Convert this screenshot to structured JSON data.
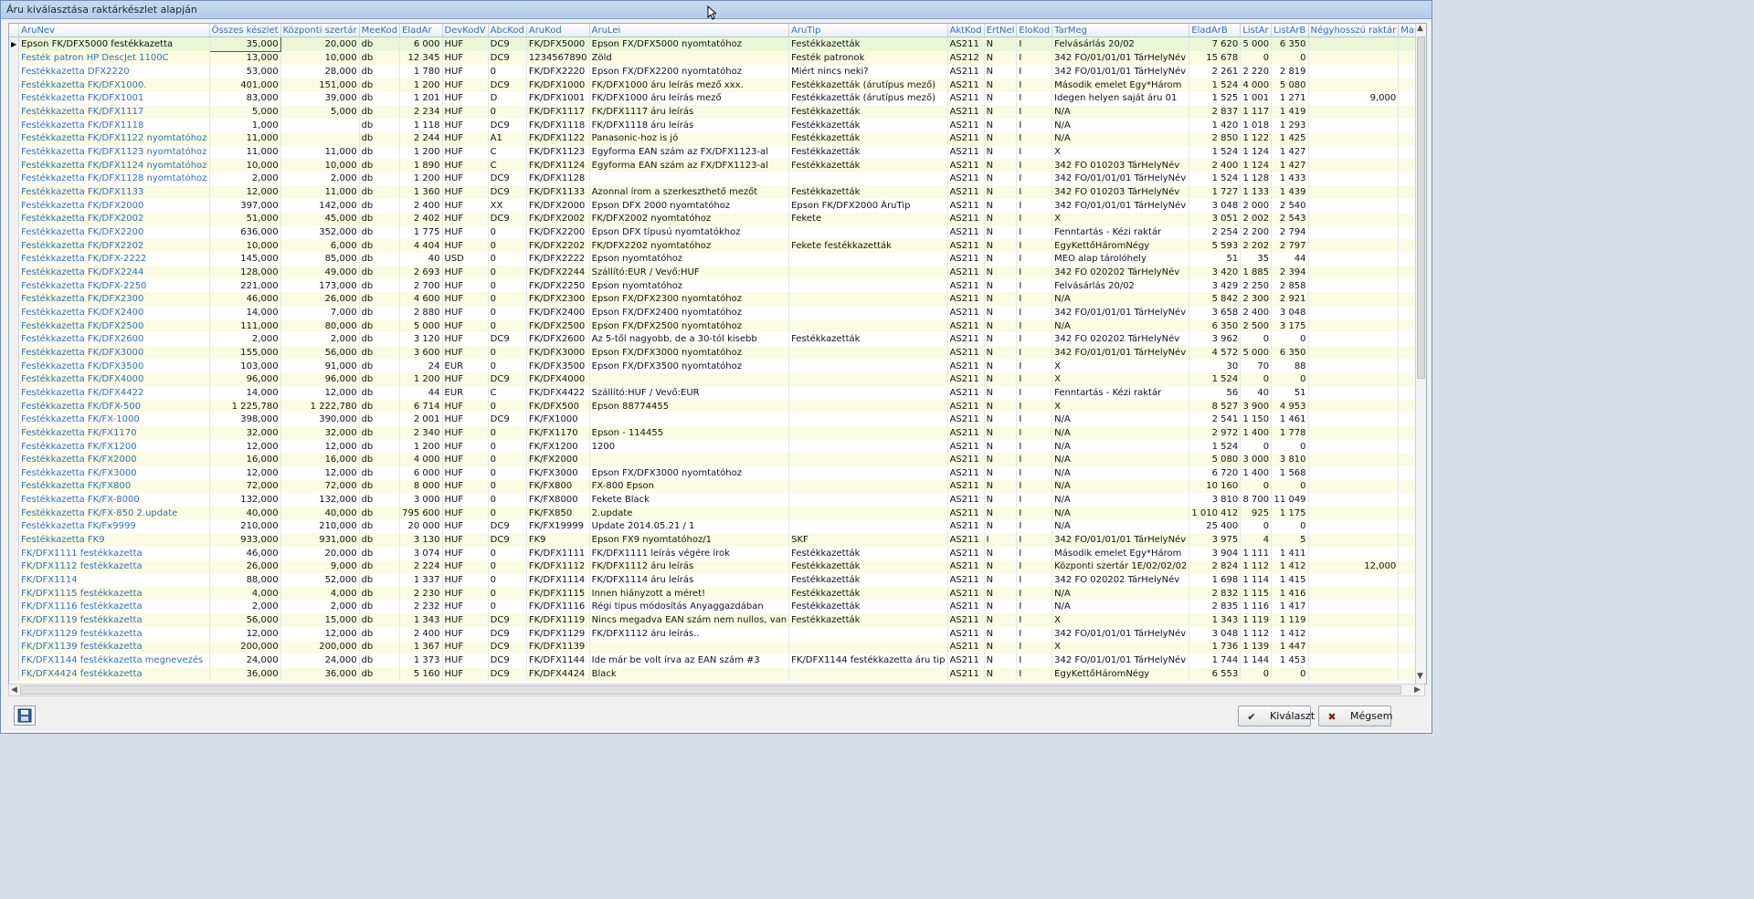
{
  "window": {
    "title": "Áru kiválasztása raktárkészlet alapján"
  },
  "grid": {
    "columns": [
      "AruNev",
      "Összes készlet",
      "Központi szertár",
      "MeeKod",
      "EladAr",
      "DevKodV",
      "AbcKod",
      "AruKod",
      "AruLei",
      "AruTip",
      "AktKod",
      "ErtNel",
      "EloKod",
      "TarMeg",
      "EladArB",
      "ListAr",
      "ListArB",
      "Négyhosszú raktár",
      "Mark"
    ],
    "rows": [
      [
        "Epson FK/DFX5000 festékkazetta",
        "35,000",
        "20,000",
        "db",
        "6 000",
        "HUF",
        "DC9",
        "FK/DFX5000",
        "Epson FX/DFX5000 nyomtatóhoz",
        "Festékkazetták",
        "AS211",
        "N",
        "I",
        "Felvásárlás 20/02",
        "7 620",
        "5 000",
        "6 350",
        "",
        ""
      ],
      [
        "Festék patron HP DescJet 1100C",
        "13,000",
        "10,000",
        "db",
        "12 345",
        "HUF",
        "DC9",
        "1234567890",
        "Zöld",
        "Festék patronok",
        "AS212",
        "N",
        "I",
        "342 FO/01/01/01 TárHelyNév",
        "15 678",
        "0",
        "0",
        "",
        ""
      ],
      [
        "Festékkazetta DFX2220",
        "53,000",
        "28,000",
        "db",
        "1 780",
        "HUF",
        "0",
        "FK/DFX2220",
        "Epson FX/DFX2200 nyomtatóhoz",
        "Miért nincs neki?",
        "AS211",
        "N",
        "I",
        "342 FO/01/01/01 TárHelyNév",
        "2 261",
        "2 220",
        "2 819",
        "",
        ""
      ],
      [
        "Festékkazetta FK/DFX1000.",
        "401,000",
        "151,000",
        "db",
        "1 200",
        "HUF",
        "DC9",
        "FK/DFX1000",
        "FK/DFX1000 áru leírás mező xxx.",
        "Festékkazetták (árutípus mező)",
        "AS211",
        "N",
        "I",
        "Második emelet Egy*Három",
        "1 524",
        "4 000",
        "5 080",
        "",
        ""
      ],
      [
        "Festékkazetta FK/DFX1001",
        "83,000",
        "39,000",
        "db",
        "1 201",
        "HUF",
        "D",
        "FK/DFX1001",
        "FK/DFX1000 áru leírás mező",
        "Festékkazetták (árutípus mező)",
        "AS211",
        "N",
        "I",
        "Idegen helyen saját áru 01",
        "1 525",
        "1 001",
        "1 271",
        "9,000",
        ""
      ],
      [
        "Festékkazetta FK/DFX1117",
        "5,000",
        "5,000",
        "db",
        "2 234",
        "HUF",
        "0",
        "FK/DFX1117",
        "FK/DFX1117 áru leírás",
        "Festékkazetták",
        "AS211",
        "N",
        "I",
        "N/A",
        "2 837",
        "1 117",
        "1 419",
        "",
        ""
      ],
      [
        "Festékkazetta FK/DFX1118",
        "1,000",
        "",
        "db",
        "1 118",
        "HUF",
        "DC9",
        "FK/DFX1118",
        "FK/DFX1118 áru leírás",
        "Festékkazetták",
        "AS211",
        "N",
        "I",
        "N/A",
        "1 420",
        "1 018",
        "1 293",
        "",
        ""
      ],
      [
        "Festékkazetta FK/DFX1122 nyomtatóhoz",
        "11,000",
        "",
        "db",
        "2 244",
        "HUF",
        "A1",
        "FK/DFX1122",
        "Panasonic-hoz is jó",
        "Festékkazetták",
        "AS211",
        "N",
        "I",
        "N/A",
        "2 850",
        "1 122",
        "1 425",
        "",
        ""
      ],
      [
        "Festékkazetta FK/DFX1123 nyomtatóhoz",
        "11,000",
        "11,000",
        "db",
        "1 200",
        "HUF",
        "C",
        "FK/DFX1123",
        "Egyforma EAN szám az FX/DFX1123-al",
        "Festékkazetták",
        "AS211",
        "N",
        "I",
        "X",
        "1 524",
        "1 124",
        "1 427",
        "",
        ""
      ],
      [
        "Festékkazetta FK/DFX1124 nyomtatóhoz",
        "10,000",
        "10,000",
        "db",
        "1 890",
        "HUF",
        "C",
        "FK/DFX1124",
        "Egyforma EAN szám az FX/DFX1123-al",
        "Festékkazetták",
        "AS211",
        "N",
        "I",
        "342 FO 010203  TárHelyNév",
        "2 400",
        "1 124",
        "1 427",
        "",
        ""
      ],
      [
        "Festékkazetta FK/DFX1128 nyomtatóhoz",
        "2,000",
        "2,000",
        "db",
        "1 200",
        "HUF",
        "DC9",
        "FK/DFX1128",
        "",
        "",
        "AS211",
        "N",
        "I",
        "342 FO/01/01/01 TárHelyNév",
        "1 524",
        "1 128",
        "1 433",
        "",
        ""
      ],
      [
        "Festékkazetta FK/DFX1133",
        "12,000",
        "11,000",
        "db",
        "1 360",
        "HUF",
        "DC9",
        "FK/DFX1133",
        "Azonnal írom a szerkeszthető mezőt",
        "Festékkazetták",
        "AS211",
        "N",
        "I",
        "342 FO 010203  TárHelyNév",
        "1 727",
        "1 133",
        "1 439",
        "",
        ""
      ],
      [
        "Festékkazetta FK/DFX2000",
        "397,000",
        "142,000",
        "db",
        "2 400",
        "HUF",
        "XX",
        "FK/DFX2000",
        "Epson DFX 2000 nyomtatóhoz",
        "Epson FK/DFX2000 ÁruTip",
        "AS211",
        "N",
        "I",
        "342 FO/01/01/01 TárHelyNév",
        "3 048",
        "2 000",
        "2 540",
        "",
        ""
      ],
      [
        "Festékkazetta FK/DFX2002",
        "51,000",
        "45,000",
        "db",
        "2 402",
        "HUF",
        "DC9",
        "FK/DFX2002",
        "FK/DFX2002 nyomtatóhoz",
        "Fekete",
        "AS211",
        "N",
        "I",
        "X",
        "3 051",
        "2 002",
        "2 543",
        "",
        ""
      ],
      [
        "Festékkazetta FK/DFX2200",
        "636,000",
        "352,000",
        "db",
        "1 775",
        "HUF",
        "0",
        "FK/DFX2200",
        "Epson DFX típusú nyomtatókhoz",
        "",
        "AS211",
        "N",
        "I",
        "Fenntartás - Kézi raktár",
        "2 254",
        "2 200",
        "2 794",
        "",
        ""
      ],
      [
        "Festékkazetta FK/DFX2202",
        "10,000",
        "6,000",
        "db",
        "4 404",
        "HUF",
        "0",
        "FK/DFX2202",
        "FK/DFX2202 nyomtatóhoz",
        "Fekete festékkazetták",
        "AS211",
        "N",
        "I",
        "EgyKettőHáromNégy",
        "5 593",
        "2 202",
        "2 797",
        "",
        ""
      ],
      [
        "Festékkazetta FK/DFX-2222",
        "145,000",
        "85,000",
        "db",
        "40",
        "USD",
        "0",
        "FK/DFX2222",
        "Epson nyomtatóhoz",
        "",
        "AS211",
        "N",
        "I",
        "MEO alap tárolóhely",
        "51",
        "35",
        "44",
        "",
        ""
      ],
      [
        "Festékkazetta FK/DFX2244",
        "128,000",
        "49,000",
        "db",
        "2 693",
        "HUF",
        "0",
        "FK/DFX2244",
        "Szállító:EUR / Vevő:HUF",
        "",
        "AS211",
        "N",
        "I",
        "342 FO 020202  TárHelyNév",
        "3 420",
        "1 885",
        "2 394",
        "",
        ""
      ],
      [
        "Festékkazetta FK/DFX-2250",
        "221,000",
        "173,000",
        "db",
        "2 700",
        "HUF",
        "0",
        "FK/DFX2250",
        "Epson nyomtatóhoz",
        "",
        "AS211",
        "N",
        "I",
        "Felvásárlás 20/02",
        "3 429",
        "2 250",
        "2 858",
        "",
        ""
      ],
      [
        "Festékkazetta FK/DFX2300",
        "46,000",
        "26,000",
        "db",
        "4 600",
        "HUF",
        "0",
        "FK/DFX2300",
        "Epson FX/DFX2300 nyomtatóhoz",
        "",
        "AS211",
        "N",
        "I",
        "N/A",
        "5 842",
        "2 300",
        "2 921",
        "",
        ""
      ],
      [
        "Festékkazetta FK/DFX2400",
        "14,000",
        "7,000",
        "db",
        "2 880",
        "HUF",
        "0",
        "FK/DFX2400",
        "Epson FX/DFX2400 nyomtatóhoz",
        "",
        "AS211",
        "N",
        "I",
        "342 FO/01/01/01 TárHelyNév",
        "3 658",
        "2 400",
        "3 048",
        "",
        ""
      ],
      [
        "Festékkazetta FK/DFX2500",
        "111,000",
        "80,000",
        "db",
        "5 000",
        "HUF",
        "0",
        "FK/DFX2500",
        "Epson FX/DFX2500 nyomtatóhoz",
        "",
        "AS211",
        "N",
        "I",
        "N/A",
        "6 350",
        "2 500",
        "3 175",
        "",
        ""
      ],
      [
        "Festékkazetta FK/DFX2600",
        "2,000",
        "2,000",
        "db",
        "3 120",
        "HUF",
        "DC9",
        "FK/DFX2600",
        "Az 5-től nagyobb, de a 30-tól kisebb",
        "Festékkazetták",
        "AS211",
        "N",
        "I",
        "342 FO 020202  TárHelyNév",
        "3 962",
        "0",
        "0",
        "",
        ""
      ],
      [
        "Festékkazetta FK/DFX3000",
        "155,000",
        "56,000",
        "db",
        "3 600",
        "HUF",
        "0",
        "FK/DFX3000",
        "Epson FX/DFX3000 nyomtatóhoz",
        "",
        "AS211",
        "N",
        "I",
        "342 FO/01/01/01 TárHelyNév",
        "4 572",
        "5 000",
        "6 350",
        "",
        ""
      ],
      [
        "Festékkazetta FK/DFX3500",
        "103,000",
        "91,000",
        "db",
        "24",
        "EUR",
        "0",
        "FK/DFX3500",
        "Epson FX/DFX3500 nyomtatóhoz",
        "",
        "AS211",
        "N",
        "I",
        "X",
        "30",
        "70",
        "88",
        "",
        ""
      ],
      [
        "Festékkazetta FK/DFX4000",
        "96,000",
        "96,000",
        "db",
        "1 200",
        "HUF",
        "DC9",
        "FK/DFX4000",
        "",
        "",
        "AS211",
        "N",
        "I",
        "X",
        "1 524",
        "0",
        "0",
        "",
        ""
      ],
      [
        "Festékkazetta FK/DFX4422",
        "14,000",
        "12,000",
        "db",
        "44",
        "EUR",
        "C",
        "FK/DFX4422",
        "Szállító:HUF / Vevő:EUR",
        "",
        "AS211",
        "N",
        "I",
        "Fenntartás - Kézi raktár",
        "56",
        "40",
        "51",
        "",
        ""
      ],
      [
        "Festékkazetta FK/DFX-500",
        "1 225,780",
        "1 222,780",
        "db",
        "6 714",
        "HUF",
        "0",
        "FK/DFX500",
        "Epson 88774455",
        "",
        "AS211",
        "N",
        "I",
        "X",
        "8 527",
        "3 900",
        "4 953",
        "",
        ""
      ],
      [
        "Festékkazetta FK/FX-1000",
        "398,000",
        "390,000",
        "db",
        "2 001",
        "HUF",
        "DC9",
        "FK/FX1000",
        "",
        "",
        "AS211",
        "N",
        "I",
        "N/A",
        "2 541",
        "1 150",
        "1 461",
        "",
        ""
      ],
      [
        "Festékkazetta FK/FX1170",
        "32,000",
        "32,000",
        "db",
        "2 340",
        "HUF",
        "0",
        "FK/FX1170",
        "Epson - 114455",
        "",
        "AS211",
        "N",
        "I",
        "N/A",
        "2 972",
        "1 400",
        "1 778",
        "",
        ""
      ],
      [
        "Festékkazetta FK/FX1200",
        "12,000",
        "12,000",
        "db",
        "1 200",
        "HUF",
        "0",
        "FK/FX1200",
        "1200",
        "",
        "AS211",
        "N",
        "I",
        "N/A",
        "1 524",
        "0",
        "0",
        "",
        ""
      ],
      [
        "Festékkazetta FK/FX2000",
        "16,000",
        "16,000",
        "db",
        "4 000",
        "HUF",
        "0",
        "FK/FX2000",
        "",
        "",
        "AS211",
        "N",
        "I",
        "N/A",
        "5 080",
        "3 000",
        "3 810",
        "",
        ""
      ],
      [
        "Festékkazetta FK/FX3000",
        "12,000",
        "12,000",
        "db",
        "6 000",
        "HUF",
        "0",
        "FK/FX3000",
        "Epson FX/DFX3000 nyomtatóhoz",
        "",
        "AS211",
        "N",
        "I",
        "N/A",
        "6 720",
        "1 400",
        "1 568",
        "",
        ""
      ],
      [
        "Festékkazetta FK/FX800",
        "72,000",
        "72,000",
        "db",
        "8 000",
        "HUF",
        "0",
        "FK/FX800",
        "FX-800 Epson",
        "",
        "AS211",
        "N",
        "I",
        "N/A",
        "10 160",
        "0",
        "0",
        "",
        ""
      ],
      [
        "Festékkazetta FK/FX-8000",
        "132,000",
        "132,000",
        "db",
        "3 000",
        "HUF",
        "0",
        "FK/FX8000",
        "Fekete Black",
        "",
        "AS211",
        "N",
        "I",
        "N/A",
        "3 810",
        "8 700",
        "11 049",
        "",
        ""
      ],
      [
        "Festékkazetta FK/FX-850 2.update",
        "40,000",
        "40,000",
        "db",
        "795 600",
        "HUF",
        "0",
        "FK/FX850",
        "2.update",
        "",
        "AS211",
        "N",
        "I",
        "N/A",
        "1 010 412",
        "925",
        "1 175",
        "",
        ""
      ],
      [
        "Festékkazetta FK/Fx9999",
        "210,000",
        "210,000",
        "db",
        "20 000",
        "HUF",
        "DC9",
        "FK/FX19999",
        "Update 2014.05.21 / 1",
        "",
        "AS211",
        "N",
        "I",
        "N/A",
        "25 400",
        "0",
        "0",
        "",
        ""
      ],
      [
        "Festékkazetta FK9",
        "933,000",
        "931,000",
        "db",
        "3 130",
        "HUF",
        "DC9",
        "FK9",
        "Epson FX9 nyomtatóhoz/1",
        "SKF",
        "AS211",
        "I",
        "I",
        "342 FO/01/01/01 TárHelyNév",
        "3 975",
        "4",
        "5",
        "",
        ""
      ],
      [
        "FK/DFX1111 festékkazetta",
        "46,000",
        "20,000",
        "db",
        "3 074",
        "HUF",
        "0",
        "FK/DFX1111",
        "FK/DFX1111 leírás végére írok",
        "Festékkazetták",
        "AS211",
        "N",
        "I",
        "Második emelet Egy*Három",
        "3 904",
        "1 111",
        "1 411",
        "",
        ""
      ],
      [
        "FK/DFX1112 festékkazetta",
        "26,000",
        "9,000",
        "db",
        "2 224",
        "HUF",
        "0",
        "FK/DFX1112",
        "FK/DFX1112 áru leírás",
        "Festékkazetták",
        "AS211",
        "N",
        "I",
        "Központi szertár 1E/02/02/02",
        "2 824",
        "1 112",
        "1 412",
        "12,000",
        ""
      ],
      [
        "FK/DFX1114",
        "88,000",
        "52,000",
        "db",
        "1 337",
        "HUF",
        "0",
        "FK/DFX1114",
        "FK/DFX1114 áru leírás",
        "Festékkazetták",
        "AS211",
        "N",
        "I",
        "342 FO 020202  TárHelyNév",
        "1 698",
        "1 114",
        "1 415",
        "",
        ""
      ],
      [
        "FK/DFX1115 festékkazetta",
        "4,000",
        "4,000",
        "db",
        "2 230",
        "HUF",
        "0",
        "FK/DFX1115",
        "Innen hiányzott a méret!",
        "Festékkazetták",
        "AS211",
        "N",
        "I",
        "N/A",
        "2 832",
        "1 115",
        "1 416",
        "",
        ""
      ],
      [
        "FK/DFX1116 festékkazetta",
        "2,000",
        "2,000",
        "db",
        "2 232",
        "HUF",
        "0",
        "FK/DFX1116",
        "Régi tipus módosítás Anyaggazdában",
        "Festékkazetták",
        "AS211",
        "N",
        "I",
        "N/A",
        "2 835",
        "1 116",
        "1 417",
        "",
        ""
      ],
      [
        "FK/DFX1119 festékkazetta",
        "56,000",
        "15,000",
        "db",
        "1 343",
        "HUF",
        "DC9",
        "FK/DFX1119",
        "Nincs megadva EAN szám nem nullos, van",
        "Festékkazetták",
        "AS211",
        "N",
        "I",
        "X",
        "1 343",
        "1 119",
        "1 119",
        "",
        ""
      ],
      [
        "FK/DFX1129 festékkazetta",
        "12,000",
        "12,000",
        "db",
        "2 400",
        "HUF",
        "DC9",
        "FK/DFX1129",
        "FK/DFX1112 áru leírás..",
        "",
        "AS211",
        "N",
        "I",
        "342 FO/01/01/01 TárHelyNév",
        "3 048",
        "1 112",
        "1 412",
        "",
        ""
      ],
      [
        "FK/DFX1139 festékkazetta",
        "200,000",
        "200,000",
        "db",
        "1 367",
        "HUF",
        "DC9",
        "FK/DFX1139",
        "",
        "",
        "AS211",
        "N",
        "I",
        "X",
        "1 736",
        "1 139",
        "1 447",
        "",
        ""
      ],
      [
        "FK/DFX1144 festékkazetta megnevezés",
        "24,000",
        "24,000",
        "db",
        "1 373",
        "HUF",
        "DC9",
        "FK/DFX1144",
        "Ide már be volt írva az EAN szám #3",
        "FK/DFX1144 festékkazetta áru tip",
        "AS211",
        "N",
        "I",
        "342 FO/01/01/01 TárHelyNév",
        "1 744",
        "1 144",
        "1 453",
        "",
        ""
      ],
      [
        "FK/DFX4424 festékkazetta",
        "36,000",
        "36,000",
        "db",
        "5 160",
        "HUF",
        "DC9",
        "FK/DFX4424",
        "Black",
        "",
        "AS211",
        "N",
        "I",
        "EgyKettőHáromNégy",
        "6 553",
        "0",
        "0",
        "",
        ""
      ]
    ]
  },
  "buttons": {
    "select": "Kiválaszt",
    "cancel": "Mégsem"
  },
  "icons": {
    "save": "save-icon",
    "check": "check-icon",
    "cross": "cross-icon",
    "row_pointer": "row-pointer-icon"
  },
  "colors": {
    "link_text": "#2f6fb4",
    "odd_row": "#fbfbe3",
    "selected_row": "#e9f7d7",
    "cancel_icon": "#8b1a1a"
  }
}
